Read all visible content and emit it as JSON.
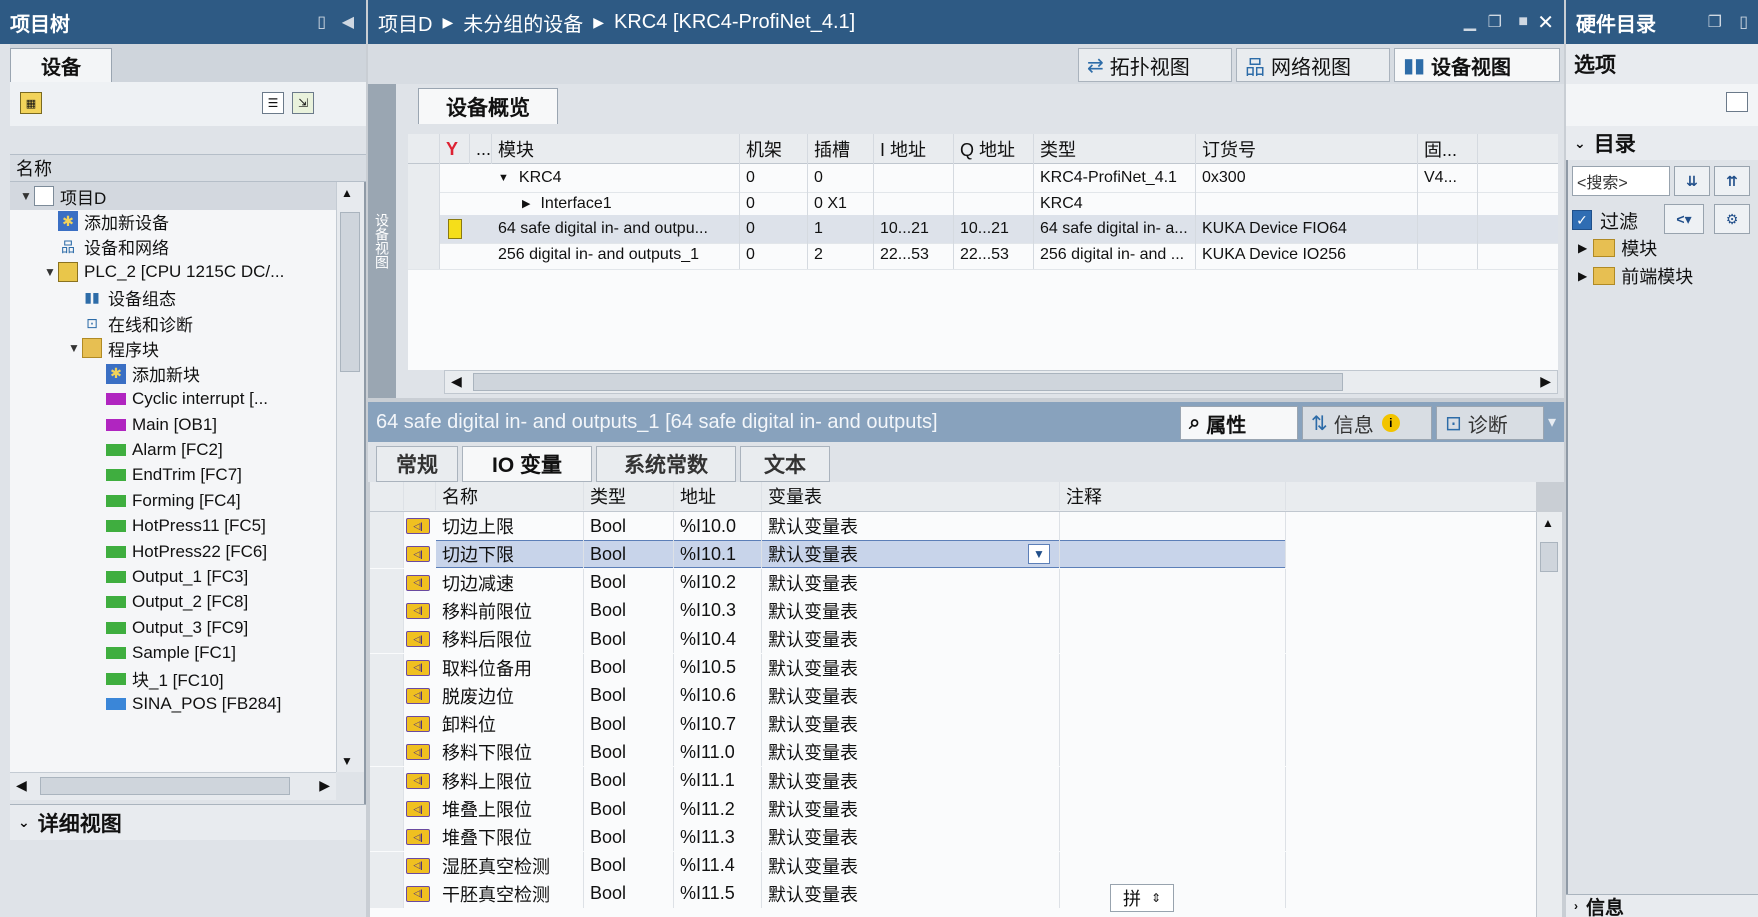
{
  "project_tree": {
    "title": "项目树",
    "tab": "设备",
    "column_header": "名称",
    "items": [
      {
        "label": "项目D",
        "icon": "project-icon",
        "twisty": "▼",
        "indent": 0
      },
      {
        "label": "添加新设备",
        "icon": "add-device-icon",
        "twisty": "",
        "indent": 1
      },
      {
        "label": "设备和网络",
        "icon": "network-icon",
        "twisty": "",
        "indent": 1
      },
      {
        "label": "PLC_2 [CPU 1215C DC/...",
        "icon": "plc-icon",
        "twisty": "▼",
        "indent": 1
      },
      {
        "label": "设备组态",
        "icon": "device-config-icon",
        "twisty": "",
        "indent": 2
      },
      {
        "label": "在线和诊断",
        "icon": "diagnostics-icon",
        "twisty": "",
        "indent": 2
      },
      {
        "label": "程序块",
        "icon": "program-blocks-icon",
        "twisty": "▼",
        "indent": 2
      },
      {
        "label": "添加新块",
        "icon": "add-block-icon",
        "twisty": "",
        "indent": 3
      },
      {
        "label": "Cyclic interrupt [...",
        "icon": "ob-icon",
        "twisty": "",
        "indent": 3
      },
      {
        "label": "Main [OB1]",
        "icon": "ob-icon",
        "twisty": "",
        "indent": 3
      },
      {
        "label": "Alarm [FC2]",
        "icon": "fc-icon",
        "twisty": "",
        "indent": 3
      },
      {
        "label": "EndTrim [FC7]",
        "icon": "fc-icon",
        "twisty": "",
        "indent": 3
      },
      {
        "label": "Forming [FC4]",
        "icon": "fc-icon",
        "twisty": "",
        "indent": 3
      },
      {
        "label": "HotPress11 [FC5]",
        "icon": "fc-icon",
        "twisty": "",
        "indent": 3
      },
      {
        "label": "HotPress22 [FC6]",
        "icon": "fc-icon",
        "twisty": "",
        "indent": 3
      },
      {
        "label": "Output_1 [FC3]",
        "icon": "fc-icon",
        "twisty": "",
        "indent": 3
      },
      {
        "label": "Output_2 [FC8]",
        "icon": "fc-icon",
        "twisty": "",
        "indent": 3
      },
      {
        "label": "Output_3 [FC9]",
        "icon": "fc-icon",
        "twisty": "",
        "indent": 3
      },
      {
        "label": "Sample [FC1]",
        "icon": "fc-icon",
        "twisty": "",
        "indent": 3
      },
      {
        "label": "块_1 [FC10]",
        "icon": "fc-icon",
        "twisty": "",
        "indent": 3
      },
      {
        "label": "SINA_POS [FB284]",
        "icon": "fb-icon",
        "twisty": "",
        "indent": 3
      }
    ],
    "detail_view": "详细视图"
  },
  "editor": {
    "breadcrumb": [
      "项目D",
      "未分组的设备",
      "KRC4 [KRC4-ProfiNet_4.1]"
    ],
    "view_tabs": [
      "拓扑视图",
      "网络视图",
      "设备视图"
    ],
    "side_label": "设备视图",
    "overview_tab": "设备概览",
    "overview_columns": [
      "模块",
      "机架",
      "插槽",
      "I 地址",
      "Q 地址",
      "类型",
      "订货号",
      "固..."
    ],
    "overview_rows": [
      {
        "module": "KRC4",
        "twisty": "▼",
        "rack": "0",
        "slot": "0",
        "i_addr": "",
        "q_addr": "",
        "type": "KRC4-ProfiNet_4.1",
        "order": "0x300",
        "fw": "V4..."
      },
      {
        "module": "Interface1",
        "twisty": "▶",
        "rack": "0",
        "slot": "0 X1",
        "i_addr": "",
        "q_addr": "",
        "type": "KRC4",
        "order": "",
        "fw": ""
      },
      {
        "module": "64 safe digital in- and outpu...",
        "twisty": "",
        "rack": "0",
        "slot": "1",
        "i_addr": "10...21",
        "q_addr": "10...21",
        "type": "64 safe digital in- a...",
        "order": "KUKA Device FIO64",
        "fw": ""
      },
      {
        "module": "256 digital in- and outputs_1",
        "twisty": "",
        "rack": "0",
        "slot": "2",
        "i_addr": "22...53",
        "q_addr": "22...53",
        "type": "256 digital in- and ...",
        "order": "KUKA Device IO256",
        "fw": ""
      }
    ]
  },
  "properties": {
    "title": "64 safe digital in- and outputs_1 [64 safe digital in- and outputs]",
    "tabs": [
      "属性",
      "信息",
      "诊断"
    ],
    "sub_tabs": [
      "常规",
      "IO 变量",
      "系统常数",
      "文本"
    ],
    "columns": [
      "名称",
      "类型",
      "地址",
      "变量表",
      "注释"
    ],
    "rows": [
      {
        "name": "切边上限",
        "type": "Bool",
        "addr": "%I10.0",
        "table": "默认变量表"
      },
      {
        "name": "切边下限",
        "type": "Bool",
        "addr": "%I10.1",
        "table": "默认变量表"
      },
      {
        "name": "切边减速",
        "type": "Bool",
        "addr": "%I10.2",
        "table": "默认变量表"
      },
      {
        "name": "移料前限位",
        "type": "Bool",
        "addr": "%I10.3",
        "table": "默认变量表"
      },
      {
        "name": "移料后限位",
        "type": "Bool",
        "addr": "%I10.4",
        "table": "默认变量表"
      },
      {
        "name": "取料位备用",
        "type": "Bool",
        "addr": "%I10.5",
        "table": "默认变量表"
      },
      {
        "name": "脱废边位",
        "type": "Bool",
        "addr": "%I10.6",
        "table": "默认变量表"
      },
      {
        "name": "卸料位",
        "type": "Bool",
        "addr": "%I10.7",
        "table": "默认变量表"
      },
      {
        "name": "移料下限位",
        "type": "Bool",
        "addr": "%I11.0",
        "table": "默认变量表"
      },
      {
        "name": "移料上限位",
        "type": "Bool",
        "addr": "%I11.1",
        "table": "默认变量表"
      },
      {
        "name": "堆叠上限位",
        "type": "Bool",
        "addr": "%I11.2",
        "table": "默认变量表"
      },
      {
        "name": "堆叠下限位",
        "type": "Bool",
        "addr": "%I11.3",
        "table": "默认变量表"
      },
      {
        "name": "湿胚真空检测",
        "type": "Bool",
        "addr": "%I11.4",
        "table": "默认变量表"
      },
      {
        "name": "干胚真空检测",
        "type": "Bool",
        "addr": "%I11.5",
        "table": "默认变量表"
      }
    ],
    "ime_indicator": "拼"
  },
  "hardware_catalog": {
    "title": "硬件目录",
    "options": "选项",
    "catalog": "目录",
    "search_placeholder": "<搜索>",
    "filter_label": "过滤",
    "tree": [
      "模块",
      "前端模块"
    ],
    "info": "信息"
  },
  "colors": {
    "title_bar": "#2e5a84",
    "selection": "#c8d4ea",
    "tag_icon": "#f0c020"
  }
}
